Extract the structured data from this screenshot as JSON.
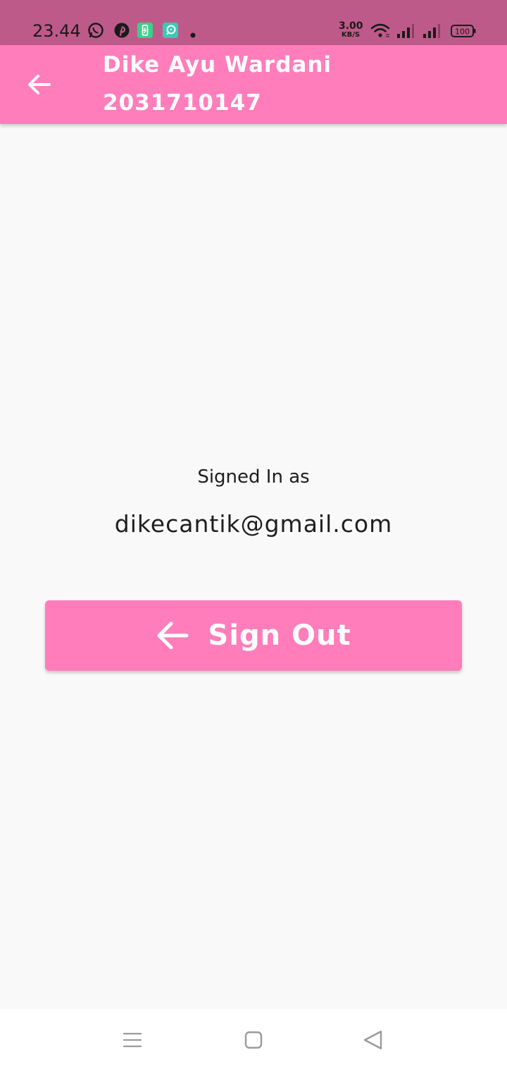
{
  "status_bar": {
    "time": "23.44",
    "net_speed_value": "3.00",
    "net_speed_unit": "KB/S",
    "battery": "100",
    "icons": [
      "whatsapp-icon",
      "pinterest-icon",
      "battery-saver-app-icon",
      "chat-app-icon",
      "notification-dot-icon",
      "wifi-icon",
      "signal-sim1-icon",
      "signal-sim2-icon",
      "battery-icon"
    ]
  },
  "app_bar": {
    "title_line1": "Dike Ayu Wardani",
    "title_line2": "2031710147",
    "back_icon": "arrow-back-icon"
  },
  "main": {
    "signed_in_label": "Signed In as",
    "email": "dikecantik@gmail.com",
    "sign_out_label": "Sign Out",
    "sign_out_icon": "arrow-back-icon"
  },
  "nav_bar": {
    "icons": [
      "menu-icon",
      "home-icon",
      "back-triangle-icon"
    ]
  },
  "colors": {
    "status_bar": "#be5a8a",
    "primary": "#ff7dbb",
    "background": "#f9f9f9",
    "text": "#1e1e1e"
  }
}
